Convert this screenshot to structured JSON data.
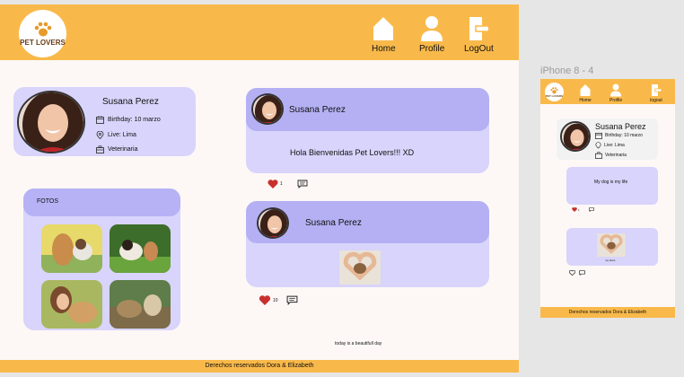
{
  "brand": {
    "logo_text": "PET LOVERS"
  },
  "nav": {
    "home": "Home",
    "profile": "Profile",
    "logout": "LogOut"
  },
  "profile": {
    "name": "Susana Perez",
    "birthday": "Birthday: 10 marzo",
    "live": "Live: Lima",
    "job": "Veterinaria"
  },
  "fotos": {
    "title": "FOTOS"
  },
  "posts": [
    {
      "author": "Susana Perez",
      "text": "Hola Bienvenidas Pet Lovers!!! XD",
      "likes": "1"
    },
    {
      "author": "Susana Perez",
      "likes": "10"
    }
  ],
  "footnote": "today is a beautifull day",
  "footer": "Derechos reservados Dora & Elizabeth",
  "mobile": {
    "frame_label": "iPhone 8 - 4",
    "logo_text": "PET LOVERS",
    "nav": {
      "home": "Home",
      "profile": "Profile",
      "logout": "logout"
    },
    "profile": {
      "name": "Susana Perez",
      "birthday": "Birthday: 10 marzo",
      "live": "Live: Lima",
      "job": "Veterinaria"
    },
    "post1_text": "My dog  is my life",
    "post1_likes": "1",
    "post2_caption": "my fotos",
    "footer": "Derechos reservados Dora & Elizabeth"
  },
  "colors": {
    "header": "#f9b94a",
    "card": "#d8d4fb",
    "card_header": "#b4b0f3",
    "page_bg": "#fdf8f6"
  }
}
